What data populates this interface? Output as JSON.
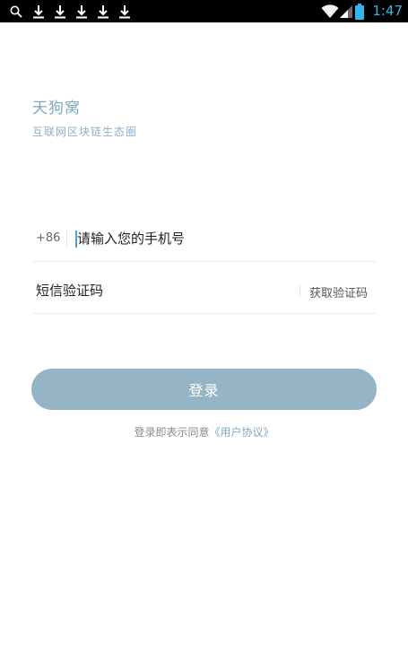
{
  "status_bar": {
    "time": "1:47",
    "left_icons": [
      "search-icon",
      "download-icon",
      "download-icon",
      "download-icon",
      "download-icon",
      "download-icon"
    ],
    "right_icons": [
      "wifi-icon",
      "signal-icon",
      "battery-icon"
    ],
    "time_color": "#33b5e5"
  },
  "brand": {
    "title": "天狗窝",
    "subtitle": "互联网区块链生态圈"
  },
  "login_form": {
    "country_code": "+86",
    "phone_placeholder": "请输入您的手机号",
    "code_placeholder": "短信验证码",
    "get_code_label": "获取验证码",
    "login_label": "登录",
    "agreement_prefix": "登录即表示同意",
    "agreement_link": "《用户协议》"
  },
  "colors": {
    "accent": "#7fa8c2",
    "button": "#95b4c6"
  }
}
